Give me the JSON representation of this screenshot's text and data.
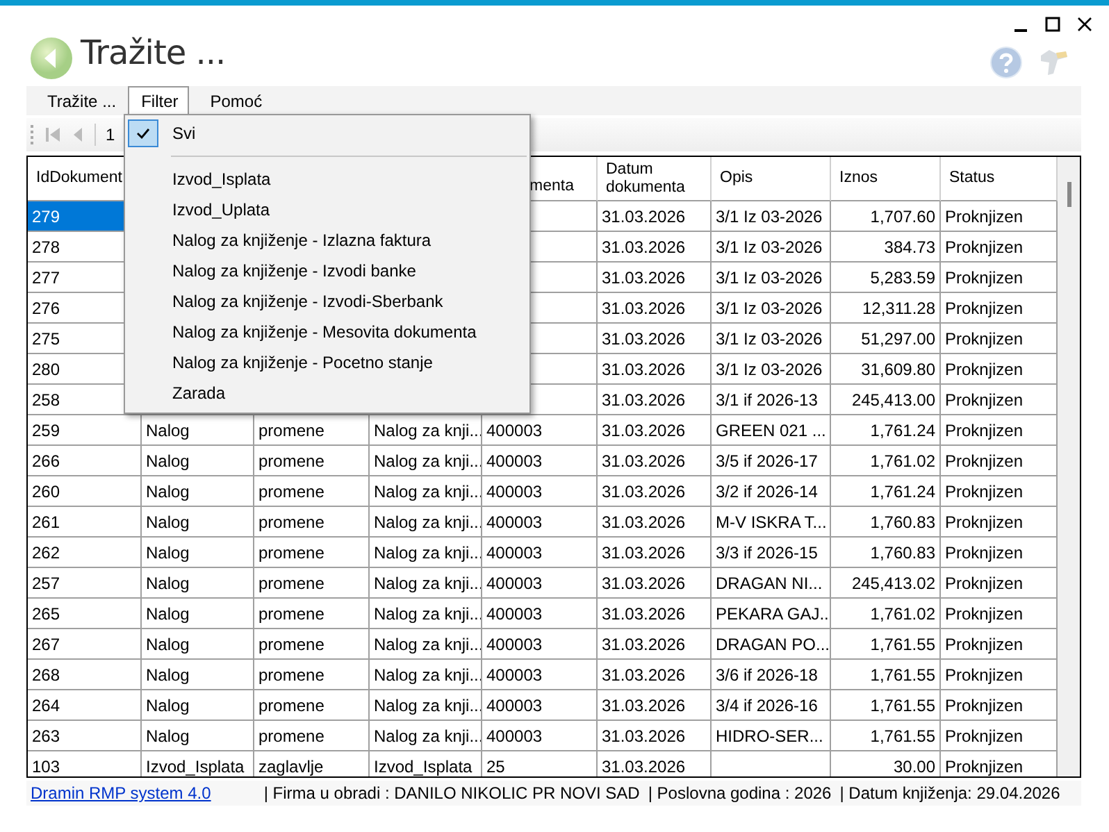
{
  "window": {
    "title": "Tražite ..."
  },
  "menu": [
    {
      "label": "Tražite ...",
      "selected": false
    },
    {
      "label": "Filter",
      "selected": true
    },
    {
      "label": "Pomoć",
      "selected": false
    }
  ],
  "pager": {
    "page": "1"
  },
  "filter_menu": [
    {
      "label": "Svi",
      "checked": true,
      "kind": "item"
    },
    {
      "kind": "separator"
    },
    {
      "label": "Izvod_Isplata",
      "checked": false,
      "kind": "item"
    },
    {
      "label": "Izvod_Uplata",
      "checked": false,
      "kind": "item"
    },
    {
      "label": "Nalog za knjiženje - Izlazna faktura",
      "checked": false,
      "kind": "item"
    },
    {
      "label": "Nalog za knjiženje - Izvodi banke",
      "checked": false,
      "kind": "item"
    },
    {
      "label": "Nalog za knjiženje - Izvodi-Sberbank",
      "checked": false,
      "kind": "item"
    },
    {
      "label": "Nalog za knjiženje - Mesovita dokumenta",
      "checked": false,
      "kind": "item"
    },
    {
      "label": "Nalog za knjiženje - Pocetno stanje",
      "checked": false,
      "kind": "item"
    },
    {
      "label": "Zarada",
      "checked": false,
      "kind": "item"
    }
  ],
  "table": {
    "columns": [
      "IdDokument",
      null,
      null,
      null,
      "menta",
      "Datum dokumenta",
      "Opis",
      "Iznos",
      "Status"
    ],
    "rows": [
      {
        "selected": true,
        "cells": [
          "279",
          null,
          null,
          null,
          null,
          "31.03.2026",
          "3/1 Iz 03-2026",
          "1,707.60",
          "Proknjizen"
        ]
      },
      {
        "selected": false,
        "cells": [
          "278",
          null,
          null,
          null,
          null,
          "31.03.2026",
          "3/1 Iz 03-2026",
          "384.73",
          "Proknjizen"
        ]
      },
      {
        "selected": false,
        "cells": [
          "277",
          null,
          null,
          null,
          null,
          "31.03.2026",
          "3/1 Iz 03-2026",
          "5,283.59",
          "Proknjizen"
        ]
      },
      {
        "selected": false,
        "cells": [
          "276",
          null,
          null,
          null,
          null,
          "31.03.2026",
          "3/1 Iz 03-2026",
          "12,311.28",
          "Proknjizen"
        ]
      },
      {
        "selected": false,
        "cells": [
          "275",
          null,
          null,
          null,
          null,
          "31.03.2026",
          "3/1 Iz 03-2026",
          "51,297.00",
          "Proknjizen"
        ]
      },
      {
        "selected": false,
        "cells": [
          "280",
          null,
          null,
          null,
          null,
          "31.03.2026",
          "3/1 Iz 03-2026",
          "31,609.80",
          "Proknjizen"
        ]
      },
      {
        "selected": false,
        "cells": [
          "258",
          null,
          null,
          null,
          null,
          "31.03.2026",
          "3/1 if 2026-13",
          "245,413.00",
          "Proknjizen"
        ]
      },
      {
        "selected": false,
        "cells": [
          "259",
          "Nalog",
          "promene",
          "Nalog za knji...",
          "400003",
          "31.03.2026",
          "GREEN 021 ...",
          "1,761.24",
          "Proknjizen"
        ]
      },
      {
        "selected": false,
        "cells": [
          "266",
          "Nalog",
          "promene",
          "Nalog za knji...",
          "400003",
          "31.03.2026",
          "3/5 if 2026-17",
          "1,761.02",
          "Proknjizen"
        ]
      },
      {
        "selected": false,
        "cells": [
          "260",
          "Nalog",
          "promene",
          "Nalog za knji...",
          "400003",
          "31.03.2026",
          "3/2 if 2026-14",
          "1,761.24",
          "Proknjizen"
        ]
      },
      {
        "selected": false,
        "cells": [
          "261",
          "Nalog",
          "promene",
          "Nalog za knji...",
          "400003",
          "31.03.2026",
          "M-V ISKRA T...",
          "1,760.83",
          "Proknjizen"
        ]
      },
      {
        "selected": false,
        "cells": [
          "262",
          "Nalog",
          "promene",
          "Nalog za knji...",
          "400003",
          "31.03.2026",
          "3/3 if 2026-15",
          "1,760.83",
          "Proknjizen"
        ]
      },
      {
        "selected": false,
        "cells": [
          "257",
          "Nalog",
          "promene",
          "Nalog za knji...",
          "400003",
          "31.03.2026",
          "DRAGAN NI...",
          "245,413.02",
          "Proknjizen"
        ]
      },
      {
        "selected": false,
        "cells": [
          "265",
          "Nalog",
          "promene",
          "Nalog za knji...",
          "400003",
          "31.03.2026",
          "PEKARA GAJ...",
          "1,761.02",
          "Proknjizen"
        ]
      },
      {
        "selected": false,
        "cells": [
          "267",
          "Nalog",
          "promene",
          "Nalog za knji...",
          "400003",
          "31.03.2026",
          "DRAGAN PO...",
          "1,761.55",
          "Proknjizen"
        ]
      },
      {
        "selected": false,
        "cells": [
          "268",
          "Nalog",
          "promene",
          "Nalog za knji...",
          "400003",
          "31.03.2026",
          "3/6 if 2026-18",
          "1,761.55",
          "Proknjizen"
        ]
      },
      {
        "selected": false,
        "cells": [
          "264",
          "Nalog",
          "promene",
          "Nalog za knji...",
          "400003",
          "31.03.2026",
          "3/4 if 2026-16",
          "1,761.55",
          "Proknjizen"
        ]
      },
      {
        "selected": false,
        "cells": [
          "263",
          "Nalog",
          "promene",
          "Nalog za knji...",
          "400003",
          "31.03.2026",
          "HIDRO-SER...",
          "1,761.55",
          "Proknjizen"
        ]
      },
      {
        "selected": false,
        "cells": [
          "103",
          "Izvod_Isplata",
          "zaglavlje",
          "Izvod_Isplata",
          "25",
          "31.03.2026",
          null,
          "30.00",
          "Proknjizen"
        ]
      }
    ]
  },
  "status_bar": {
    "link": "Dramin RMP system 4.0",
    "company": "|  Firma u obradi : DANILO NIKOLIC PR NOVI SAD",
    "year": "|  Poslovna godina : 2026",
    "date": "|  Datum knjiženja: 29.04.2026"
  }
}
